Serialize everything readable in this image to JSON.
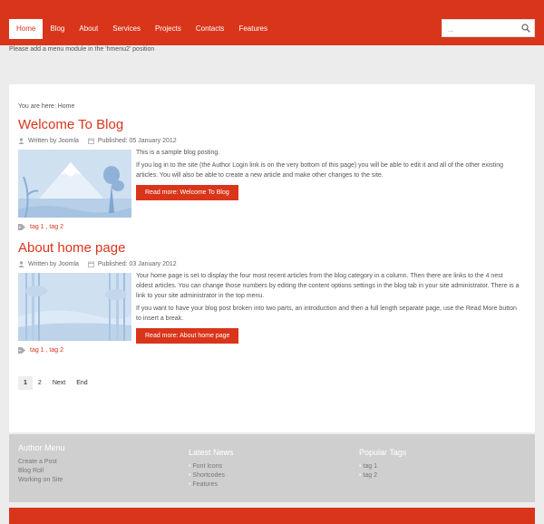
{
  "nav": {
    "items": [
      "Home",
      "Blog",
      "About",
      "Services",
      "Projects",
      "Contacts",
      "Features"
    ],
    "active": "Home"
  },
  "search": {
    "placeholder": "..."
  },
  "hmenu2_notice": "Please add a menu module in the 'hmenu2' position",
  "breadcrumb": "You are here: Home",
  "articles": [
    {
      "title": "Welcome To Blog",
      "author": "Written by Joomla",
      "published": "Published: 05 January 2012",
      "paragraphs": [
        "This is a sample blog posting.",
        "If you log in to the site (the Author Login link is on the very bottom of this page) you will be able to edit it and all of the other existing articles. You will also be able to create a new article and make other changes to the site."
      ],
      "read_more": "Read more: Welcome To Blog",
      "tags": "tag 1 , tag 2"
    },
    {
      "title": "About home page",
      "author": "Written by Joomla",
      "published": "Published: 03 January 2012",
      "paragraphs": [
        "Your home page is set to display the four most recent articles from the blog category in a column. Then there are links to the 4 nest oldest articles. You can change those numbers by editing the content options settings in the blog tab in your site administrator. There is a link to your site administrator in the top menu.",
        "If you want to have your blog post broken into two parts, an introduction and then a full length separate page, use the Read More button to insert a break."
      ],
      "read_more": "Read more: About home page",
      "tags": "tag 1 , tag 2"
    }
  ],
  "pagination": [
    "1",
    "2",
    "Next",
    "End"
  ],
  "footer": {
    "author_menu": {
      "title": "Author Menu",
      "items": [
        "Create a Post",
        "Blog Roll",
        "Working on Site"
      ]
    },
    "latest_news": {
      "title": "Latest News",
      "items": [
        "Font Icons",
        "Shortcodes",
        "Features"
      ]
    },
    "popular_tags": {
      "title": "Popular Tags",
      "items": [
        "tag 1",
        "tag 2"
      ]
    }
  },
  "colors": {
    "accent": "#d9351b",
    "background": "#ececec",
    "footer": "#cfcfcf"
  }
}
